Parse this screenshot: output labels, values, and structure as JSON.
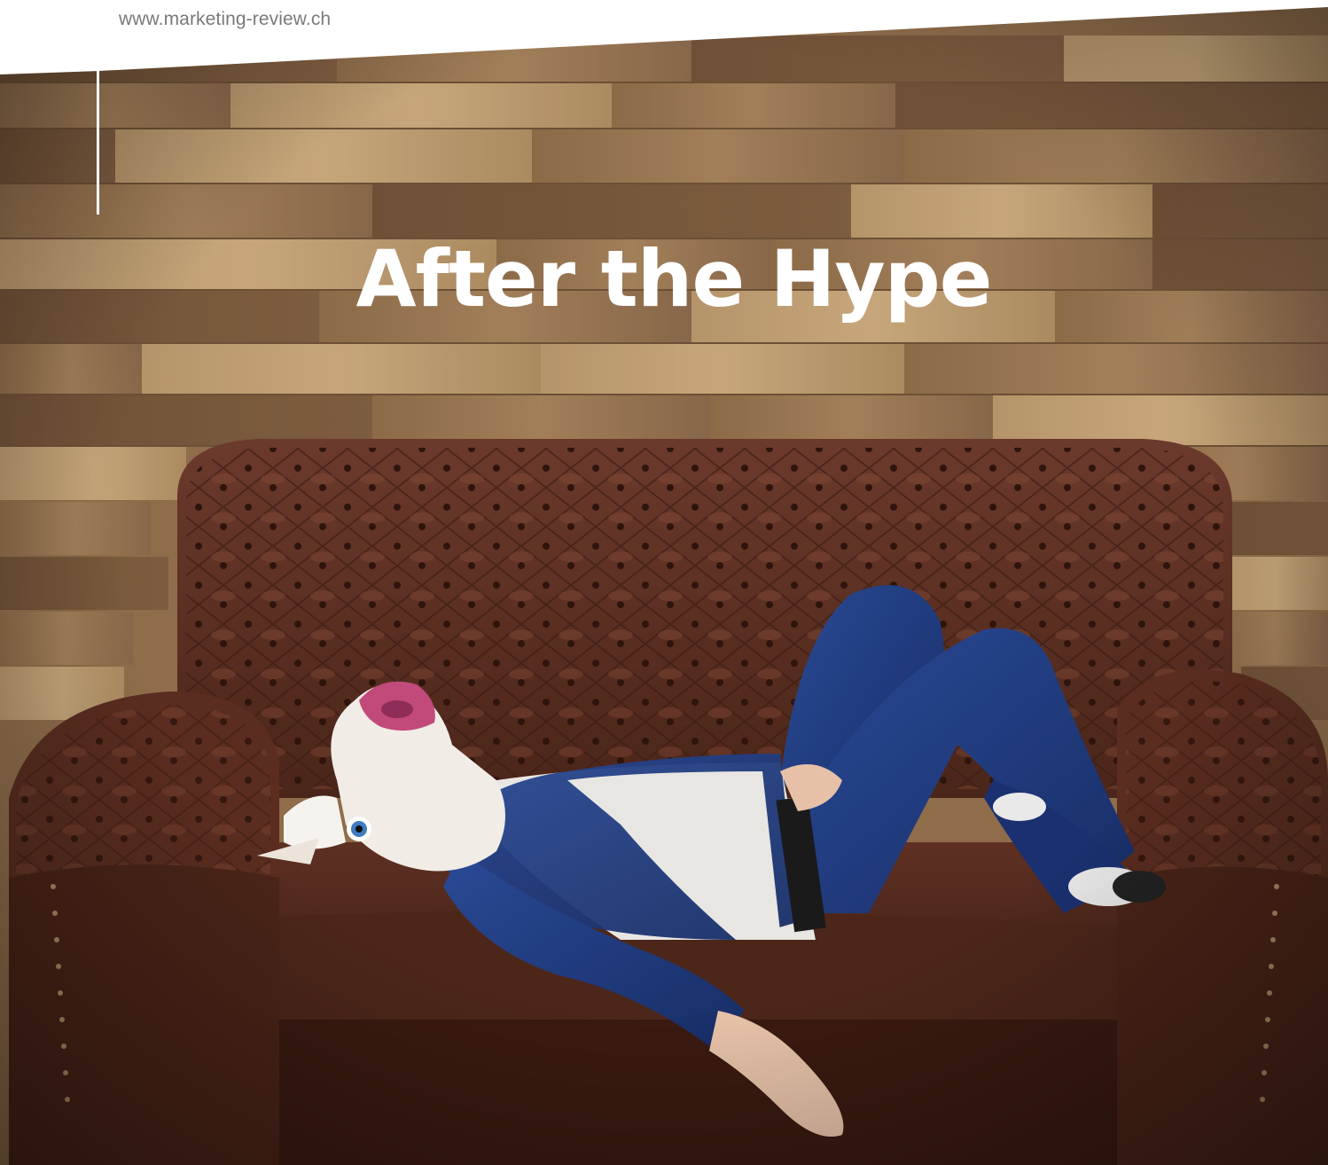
{
  "header": {
    "url": "www.marketing-review.ch"
  },
  "article": {
    "title": "After the Hype"
  },
  "photo": {
    "subject": "person-in-unicorn-mask-on-sofa",
    "colors": {
      "wall_wood": "#9a7a55",
      "sofa_leather": "#5a3024",
      "suit_blue": "#1f3a7a",
      "shirt": "#e8e6e2"
    }
  }
}
